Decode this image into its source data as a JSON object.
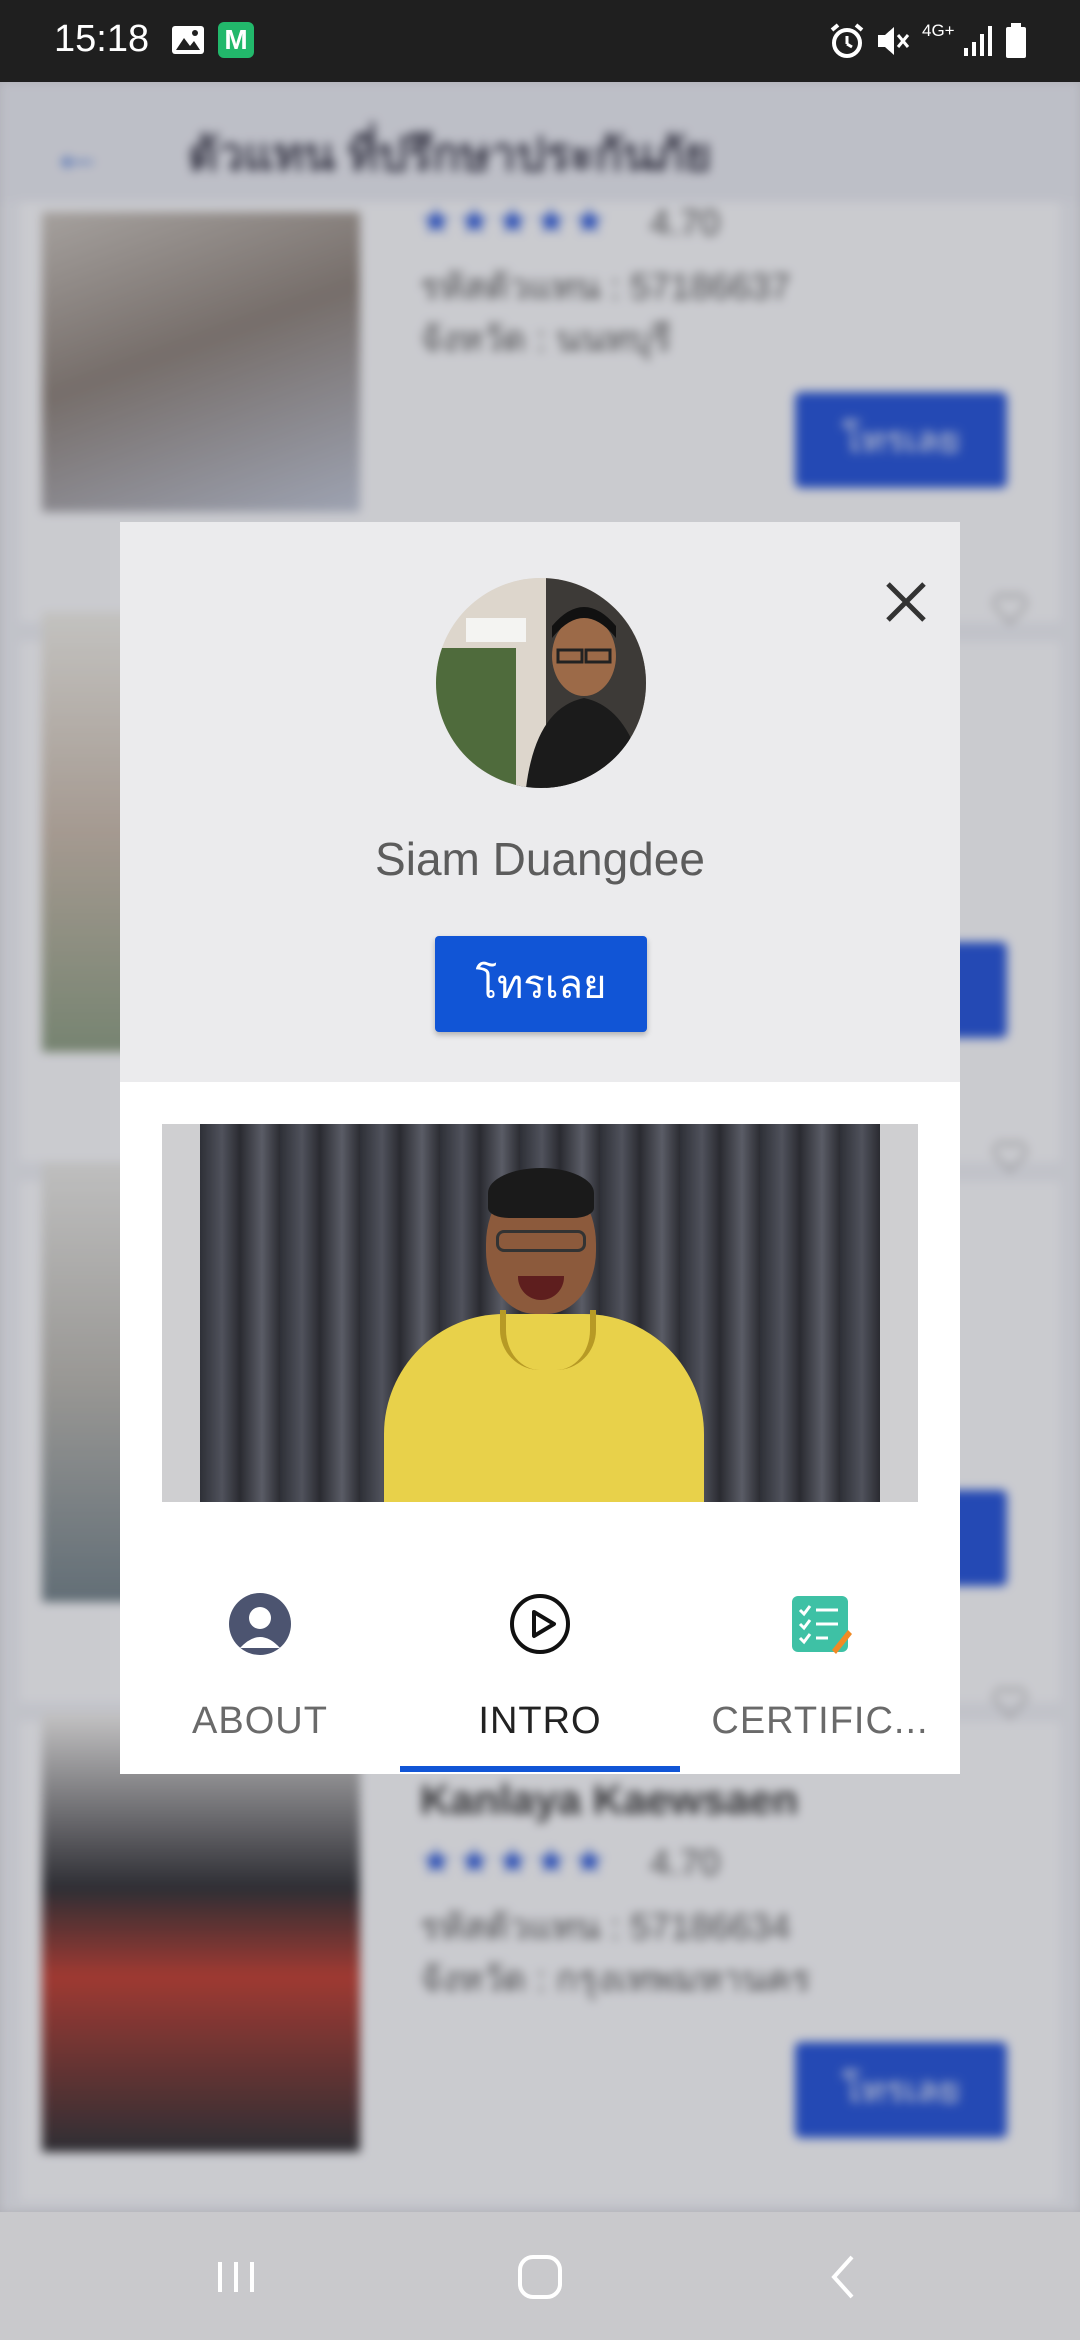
{
  "status_bar": {
    "time": "15:18",
    "network": "4G+",
    "icons": [
      "image-icon",
      "m-app-icon",
      "alarm-icon",
      "mute-icon",
      "signal-icon",
      "battery-icon"
    ]
  },
  "background": {
    "title": "ตัวแทน ที่ปรึกษาประกันภัย",
    "cards": [
      {
        "rating": "4.70",
        "code": "รหัสตัวแทน : 57186637",
        "province": "จังหวัด : นนทบุรี",
        "button": "โทรเลย"
      },
      {
        "name": "Kanlaya Kaewsaen",
        "rating": "4.70",
        "code": "รหัสตัวแทน : 57186634",
        "province": "จังหวัด : กรุงเทพมหานคร",
        "button": "โทรเลย"
      }
    ]
  },
  "modal": {
    "agent_name": "Siam Duangdee",
    "call_button": "โทรเลย",
    "tabs": [
      {
        "label": "ABOUT",
        "icon": "person-icon"
      },
      {
        "label": "INTRO",
        "icon": "play-icon"
      },
      {
        "label": "CERTIFIC...",
        "icon": "certificate-checklist-icon"
      }
    ],
    "active_tab": "INTRO",
    "accent": "#1155d6"
  }
}
